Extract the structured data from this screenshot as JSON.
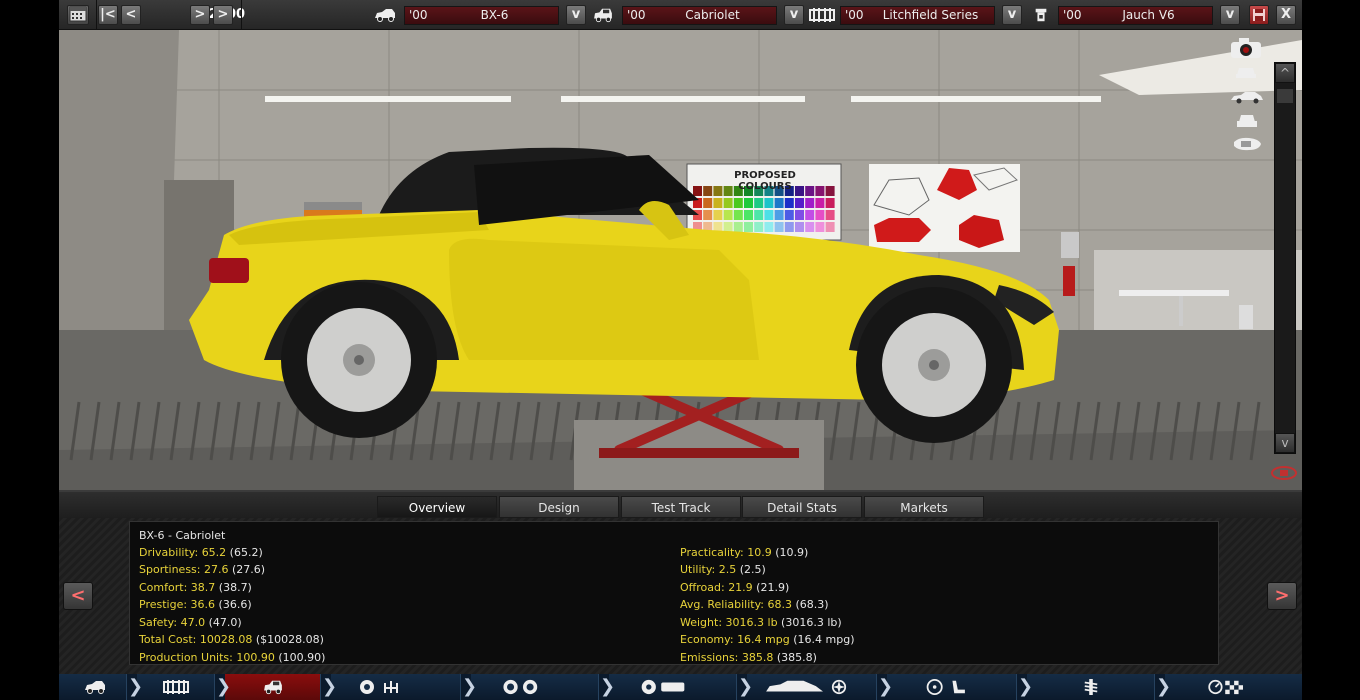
{
  "topbar": {
    "year": "2000",
    "prev_fast_label": "|<",
    "prev_label": "<",
    "next_label": ">",
    "next_fast_label": ">",
    "dropdown_label": "v",
    "close_label": "X",
    "selectors": [
      {
        "year": "'00",
        "name": "BX-6",
        "icon": "car-model-icon"
      },
      {
        "year": "'00",
        "name": "Cabriolet",
        "icon": "car-trim-icon"
      },
      {
        "year": "'00",
        "name": "Litchfield Series",
        "icon": "chassis-icon"
      },
      {
        "year": "'00",
        "name": "Jauch V6",
        "icon": "engine-icon"
      }
    ]
  },
  "viewport": {
    "poster_title": "PROPOSED COLOURS",
    "car_color": "#e8d41a",
    "side_icons": [
      "camera-icon",
      "front-view-icon",
      "side-view-icon",
      "rear-view-icon",
      "top-view-icon"
    ],
    "scroll_up": "^",
    "scroll_down": "v"
  },
  "tabs": [
    {
      "label": "Overview",
      "active": true
    },
    {
      "label": "Design",
      "active": false
    },
    {
      "label": "Test Track",
      "active": false
    },
    {
      "label": "Detail Stats",
      "active": false
    },
    {
      "label": "Markets",
      "active": false
    }
  ],
  "info": {
    "title": "BX-6 - Cabriolet",
    "left": [
      {
        "label": "Drivability: ",
        "value": "65.2",
        "paren": " (65.2)"
      },
      {
        "label": "Sportiness: ",
        "value": "27.6",
        "paren": " (27.6)"
      },
      {
        "label": "Comfort: ",
        "value": "38.7",
        "paren": " (38.7)"
      },
      {
        "label": "Prestige: ",
        "value": "36.6",
        "paren": " (36.6)"
      },
      {
        "label": "Safety: ",
        "value": "47.0",
        "paren": " (47.0)"
      },
      {
        "label": "Total Cost: ",
        "value": "10028.08",
        "paren": " ($10028.08)"
      },
      {
        "label": "Production Units: ",
        "value": "100.90",
        "paren": " (100.90)"
      }
    ],
    "right": [
      {
        "label": "Practicality: ",
        "value": "10.9",
        "paren": " (10.9)"
      },
      {
        "label": "Utility: ",
        "value": "2.5",
        "paren": " (2.5)"
      },
      {
        "label": "Offroad: ",
        "value": "21.9",
        "paren": " (21.9)"
      },
      {
        "label": "Avg. Reliability: ",
        "value": "68.3",
        "paren": " (68.3)"
      },
      {
        "label": "Weight: ",
        "value": "3016.3 lb",
        "paren": " (3016.3 lb)"
      },
      {
        "label": "Economy: ",
        "value": "16.4 mpg",
        "paren": " (16.4 mpg)"
      },
      {
        "label": "Emissions: ",
        "value": "385.8",
        "paren": " (385.8)"
      }
    ],
    "prev_label": "<",
    "next_label": ">"
  },
  "bottombar": {
    "sections": [
      {
        "icon": "car-model-icon",
        "active": false
      },
      {
        "icon": "chassis-icon",
        "active": false
      },
      {
        "icon": "car-trim-icon",
        "active": true
      },
      {
        "icon": "engine-gearbox-icon",
        "active": false
      },
      {
        "icon": "wheels-icon",
        "active": false
      },
      {
        "icon": "brakes-icon",
        "active": false
      },
      {
        "icon": "body-aero-icon",
        "active": false
      },
      {
        "icon": "interior-icon",
        "active": false
      },
      {
        "icon": "suspension-icon",
        "active": false
      },
      {
        "icon": "test-drive-icon",
        "active": false
      }
    ]
  }
}
